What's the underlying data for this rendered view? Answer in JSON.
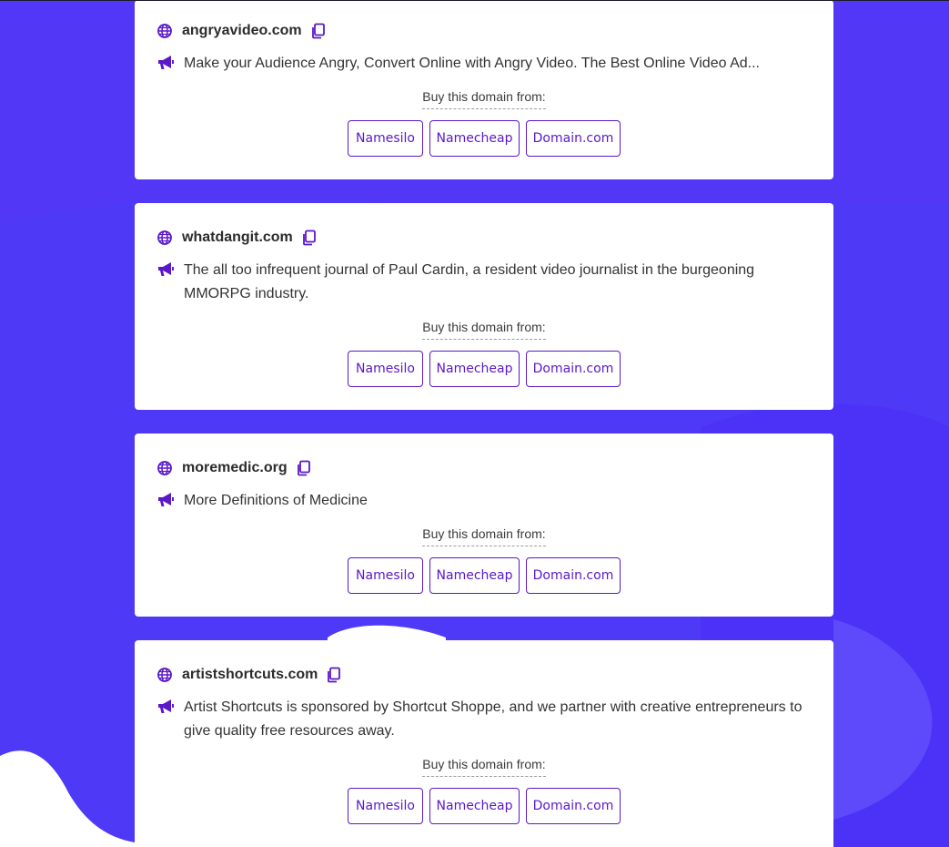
{
  "colors": {
    "background": "#5238f6",
    "accent": "#5a18c9",
    "card": "#ffffff"
  },
  "icons": {
    "domain": "globe-icon",
    "copy": "copy-icon",
    "description": "megaphone-icon"
  },
  "buy_label": "Buy this domain from:",
  "registrars": [
    "Namesilo",
    "Namecheap",
    "Domain.com"
  ],
  "listings": [
    {
      "domain": "angryavideo.com",
      "description": "Make your Audience Angry, Convert Online with Angry Video. The Best Online Video Ad..."
    },
    {
      "domain": "whatdangit.com",
      "description": "The all too infrequent journal of Paul Cardin, a resident video journalist in the burgeoning MMORPG industry."
    },
    {
      "domain": "moremedic.org",
      "description": "More Definitions of Medicine"
    },
    {
      "domain": "artistshortcuts.com",
      "description": "Artist Shortcuts is sponsored by Shortcut Shoppe, and we partner with creative entrepreneurs to give quality free resources away."
    }
  ]
}
